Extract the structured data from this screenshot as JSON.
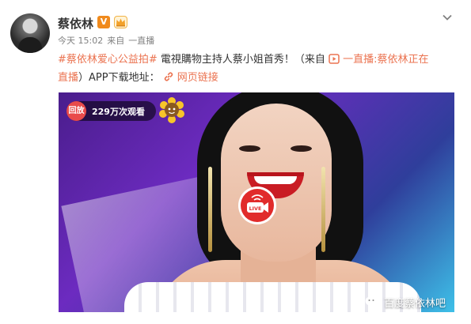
{
  "post": {
    "username": "蔡依林",
    "badge_v": "V",
    "time": "今天 15:02",
    "source_prefix": "来自",
    "source_name": "一直播"
  },
  "content": {
    "hashtag": "#蔡依林爱心公益拍#",
    "text": " 電視購物主持人蔡小姐首秀！（来自",
    "live_link_part1": "一直播:蔡依林正在",
    "live_link_part2": "直播",
    "text_tail": "）APP下载地址：",
    "web_link": "网页链接"
  },
  "media": {
    "replay_label": "回放",
    "views": "229万次观看",
    "live_label": "LIVE"
  },
  "watermark": {
    "text": "百度蔡依林吧"
  },
  "colors": {
    "accent_orange": "#eb7350",
    "replay_red": "#e94b4b",
    "live_red": "#e12b2b"
  },
  "icons": [
    "chevron-down-icon",
    "crown-icon",
    "video-play-icon",
    "link-icon",
    "sunflower-icon",
    "live-camera-icon",
    "wechat-icon"
  ]
}
